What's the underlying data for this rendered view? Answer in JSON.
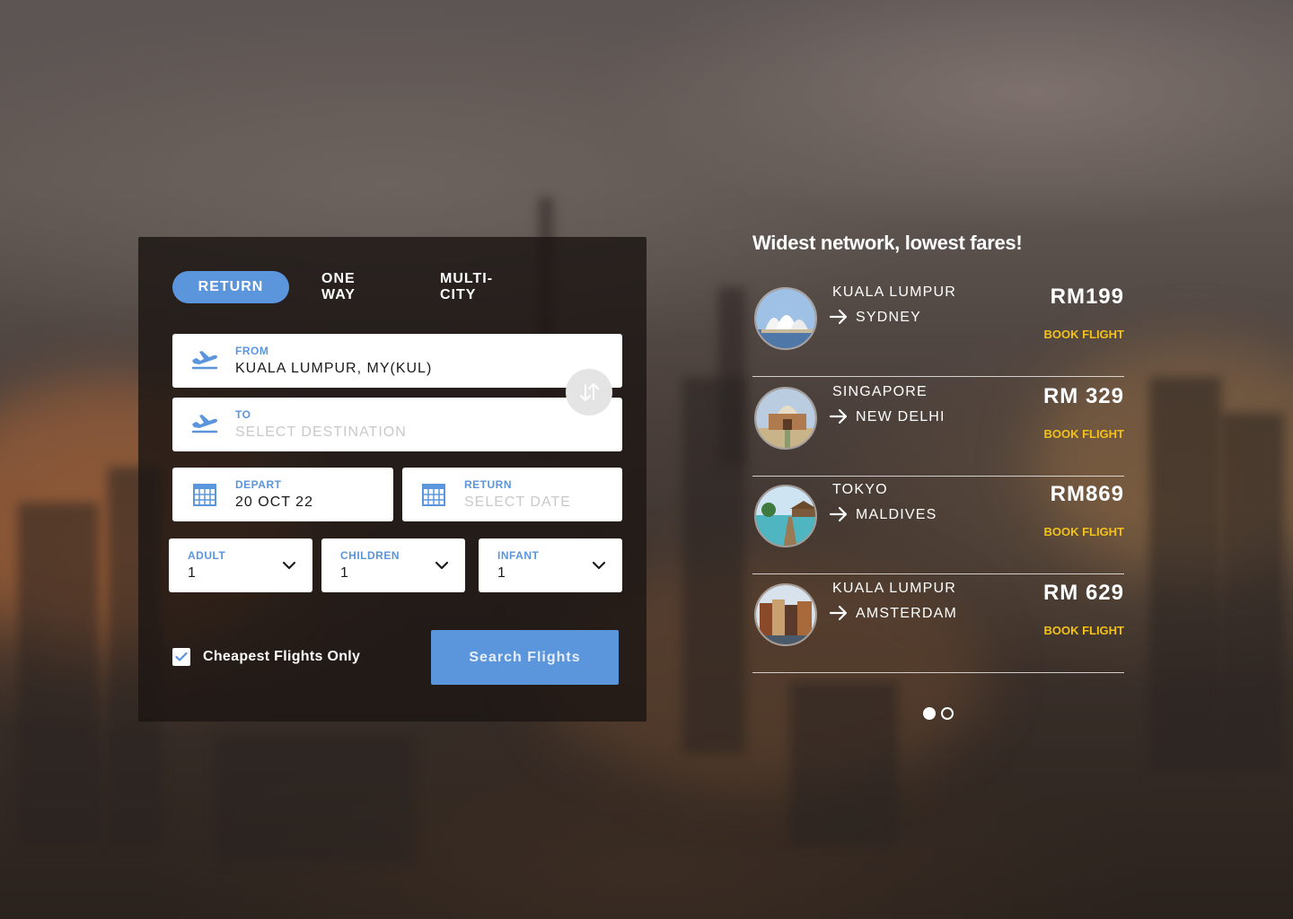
{
  "trip_tabs": [
    {
      "label": "RETURN",
      "active": true
    },
    {
      "label": "ONE WAY",
      "active": false
    },
    {
      "label": "MULTI-CITY",
      "active": false
    }
  ],
  "from_field": {
    "label": "FROM",
    "value": "KUALA LUMPUR, MY(KUL)",
    "icon": "plane-takeoff-icon"
  },
  "to_field": {
    "label": "TO",
    "placeholder": "SELECT DESTINATION",
    "icon": "plane-takeoff-icon"
  },
  "swap": {
    "icon": "swap-arrows-icon"
  },
  "depart_field": {
    "label": "DEPART",
    "value": "20 OCT 22",
    "icon": "calendar-icon"
  },
  "return_field": {
    "label": "RETURN",
    "placeholder": "SELECT DATE",
    "icon": "calendar-icon"
  },
  "passengers": [
    {
      "label": "ADULT",
      "value": "1"
    },
    {
      "label": "CHILDREN",
      "value": "1"
    },
    {
      "label": "INFANT",
      "value": "1"
    }
  ],
  "cheapest_only": {
    "label": "Cheapest Flights Only",
    "checked": true
  },
  "search_button": {
    "label": "Search Flights"
  },
  "promo": {
    "headline": "Widest network, lowest fares!",
    "deals": [
      {
        "from": "KUALA LUMPUR",
        "to": "SYDNEY",
        "price": "RM199",
        "cta": "BOOK FLIGHT",
        "image": "sydney-opera-house"
      },
      {
        "from": "SINGAPORE",
        "to": "NEW DELHI",
        "price": "RM 329",
        "cta": "BOOK FLIGHT",
        "image": "delhi-monument"
      },
      {
        "from": "TOKYO",
        "to": "MALDIVES",
        "price": "RM869",
        "cta": "BOOK FLIGHT",
        "image": "maldives-jetty"
      },
      {
        "from": "KUALA LUMPUR",
        "to": "AMSTERDAM",
        "price": "RM 629",
        "cta": "BOOK FLIGHT",
        "image": "amsterdam-houses"
      }
    ],
    "pagination": {
      "pages": 2,
      "current": 1
    }
  },
  "colors": {
    "accent": "#5b95dc",
    "book": "#f2c21b",
    "panel": "#1c1614"
  }
}
